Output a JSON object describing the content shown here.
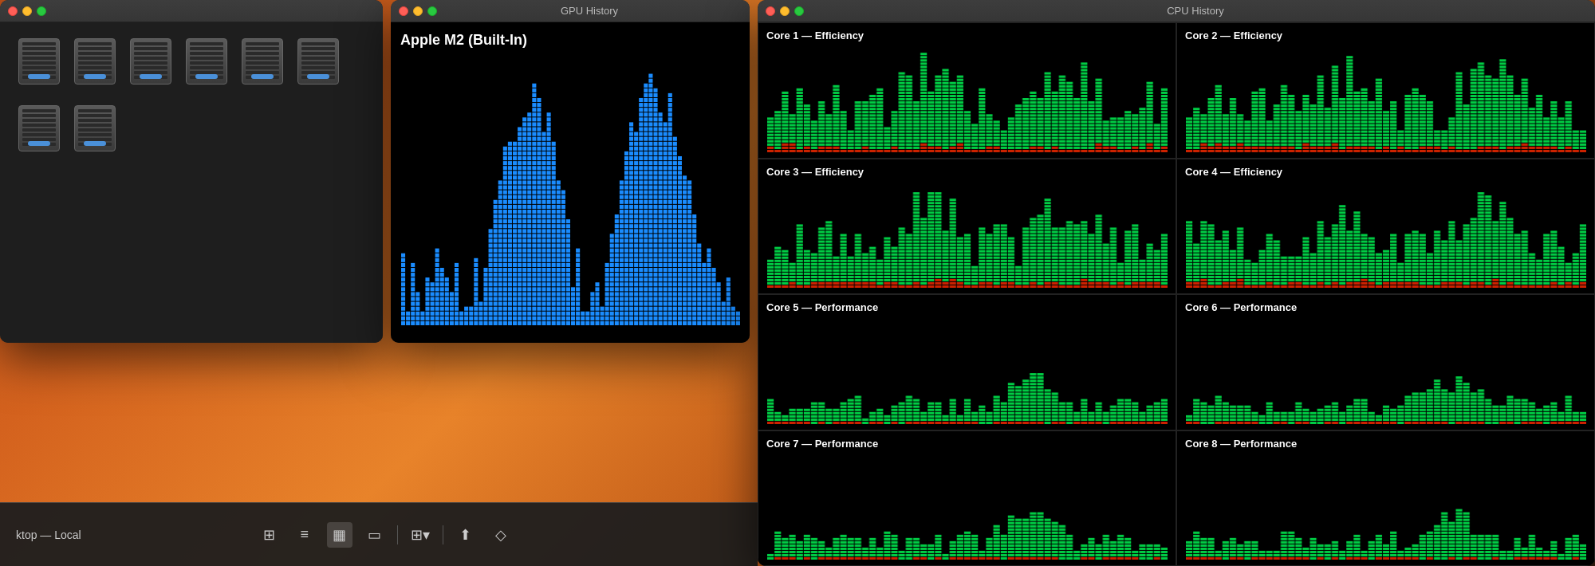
{
  "finder": {
    "title": "",
    "drives": [
      {
        "id": 1
      },
      {
        "id": 2
      },
      {
        "id": 3
      },
      {
        "id": 4
      },
      {
        "id": 5
      },
      {
        "id": 6
      },
      {
        "id": 7
      },
      {
        "id": 8
      }
    ]
  },
  "taskbar": {
    "label": "ktop — Local",
    "icons": [
      {
        "name": "grid-icon",
        "symbol": "⊞",
        "active": false
      },
      {
        "name": "list-icon",
        "symbol": "≡",
        "active": false
      },
      {
        "name": "column-icon",
        "symbol": "⊟",
        "active": true
      },
      {
        "name": "preview-icon",
        "symbol": "▭",
        "active": false
      },
      {
        "name": "apps-icon",
        "symbol": "⊞",
        "active": false
      },
      {
        "name": "share-icon",
        "symbol": "⎋",
        "active": false
      },
      {
        "name": "tag-icon",
        "symbol": "◇",
        "active": false
      }
    ]
  },
  "gpu_window": {
    "title": "GPU History",
    "gpu_label": "Apple M2 (Built-In)"
  },
  "cpu_window": {
    "title": "CPU History",
    "cores": [
      {
        "id": 1,
        "label": "Core 1 — Efficiency",
        "type": "efficiency"
      },
      {
        "id": 2,
        "label": "Core 2 — Efficiency",
        "type": "efficiency"
      },
      {
        "id": 3,
        "label": "Core 3 — Efficiency",
        "type": "efficiency"
      },
      {
        "id": 4,
        "label": "Core 4 — Efficiency",
        "type": "efficiency"
      },
      {
        "id": 5,
        "label": "Core 5 — Performance",
        "type": "performance"
      },
      {
        "id": 6,
        "label": "Core 6 — Performance",
        "type": "performance"
      },
      {
        "id": 7,
        "label": "Core 7 — Performance",
        "type": "performance"
      },
      {
        "id": 8,
        "label": "Core 8 — Performance",
        "type": "performance"
      }
    ]
  },
  "colors": {
    "gpu_bar": "#1a8cff",
    "cpu_green": "#00cc44",
    "cpu_red": "#cc2200",
    "window_bg": "#000000"
  }
}
